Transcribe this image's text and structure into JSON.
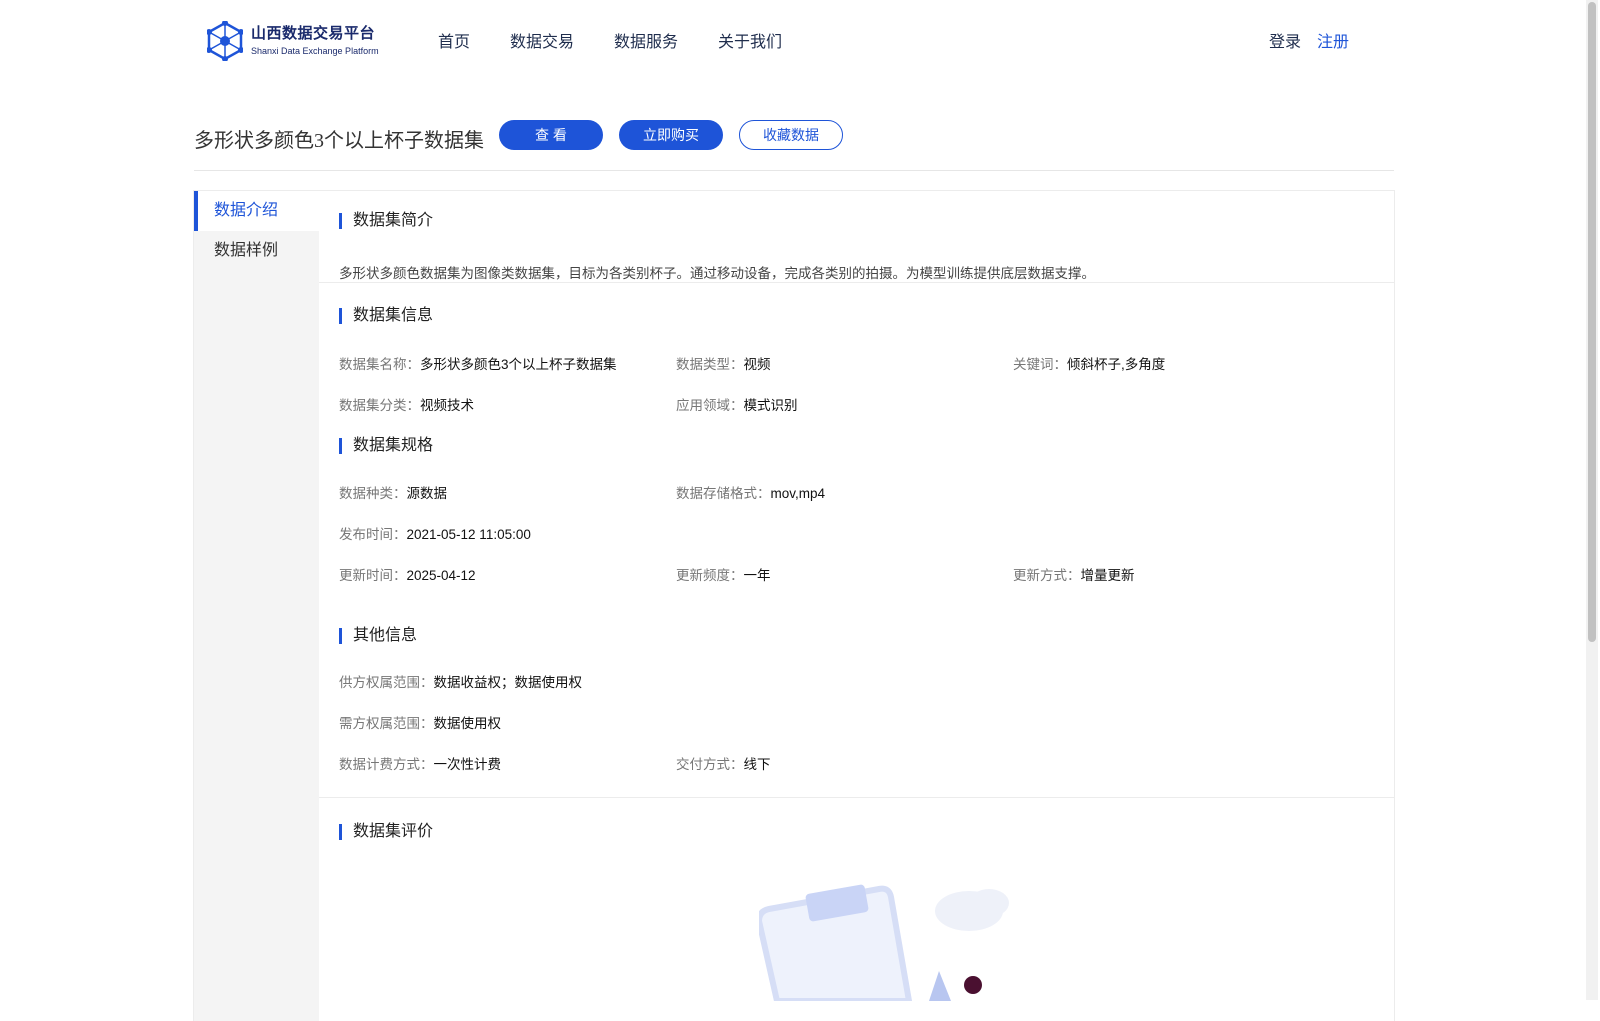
{
  "header": {
    "logo_cn": "山西数据交易平台",
    "logo_en": "Shanxi Data Exchange Platform",
    "nav": [
      "首页",
      "数据交易",
      "数据服务",
      "关于我们"
    ],
    "login": "登录",
    "register": "注册"
  },
  "dataset": {
    "title": "多形状多颜色3个以上杯子数据集",
    "btn_view": "查 看",
    "btn_buy": "立即购买",
    "btn_fav": "收藏数据"
  },
  "sidebar": {
    "items": [
      "数据介绍",
      "数据样例"
    ]
  },
  "sections": {
    "intro": {
      "title": "数据集简介",
      "text": "多形状多颜色数据集为图像类数据集，目标为各类别杯子。通过移动设备，完成各类别的拍摄。为模型训练提供底层数据支撑。"
    },
    "info": {
      "title": "数据集信息",
      "fields": [
        {
          "label": "数据集名称：",
          "value": "多形状多颜色3个以上杯子数据集"
        },
        {
          "label": "数据类型：",
          "value": "视频"
        },
        {
          "label": "关键词：",
          "value": "倾斜杯子,多角度"
        },
        {
          "label": "数据集分类：",
          "value": "视频技术"
        },
        {
          "label": "应用领域：",
          "value": "模式识别"
        }
      ]
    },
    "spec": {
      "title": "数据集规格",
      "fields": [
        {
          "label": "数据种类：",
          "value": "源数据"
        },
        {
          "label": "数据存储格式：",
          "value": "mov,mp4"
        },
        {
          "label": "发布时间：",
          "value": "2021-05-12 11:05:00"
        },
        {
          "label": "更新时间：",
          "value": "2025-04-12"
        },
        {
          "label": "更新频度：",
          "value": "一年"
        },
        {
          "label": "更新方式：",
          "value": "增量更新"
        }
      ]
    },
    "other": {
      "title": "其他信息",
      "fields": [
        {
          "label": "供方权属范围：",
          "value": "数据收益权；数据使用权"
        },
        {
          "label": "需方权属范围：",
          "value": "数据使用权"
        },
        {
          "label": "数据计费方式：",
          "value": "一次性计费"
        },
        {
          "label": "交付方式：",
          "value": "线下"
        }
      ]
    },
    "review": {
      "title": "数据集评价"
    }
  },
  "colors": {
    "accent": "#1e54d8",
    "sidebar_bg": "#f4f4f4"
  }
}
